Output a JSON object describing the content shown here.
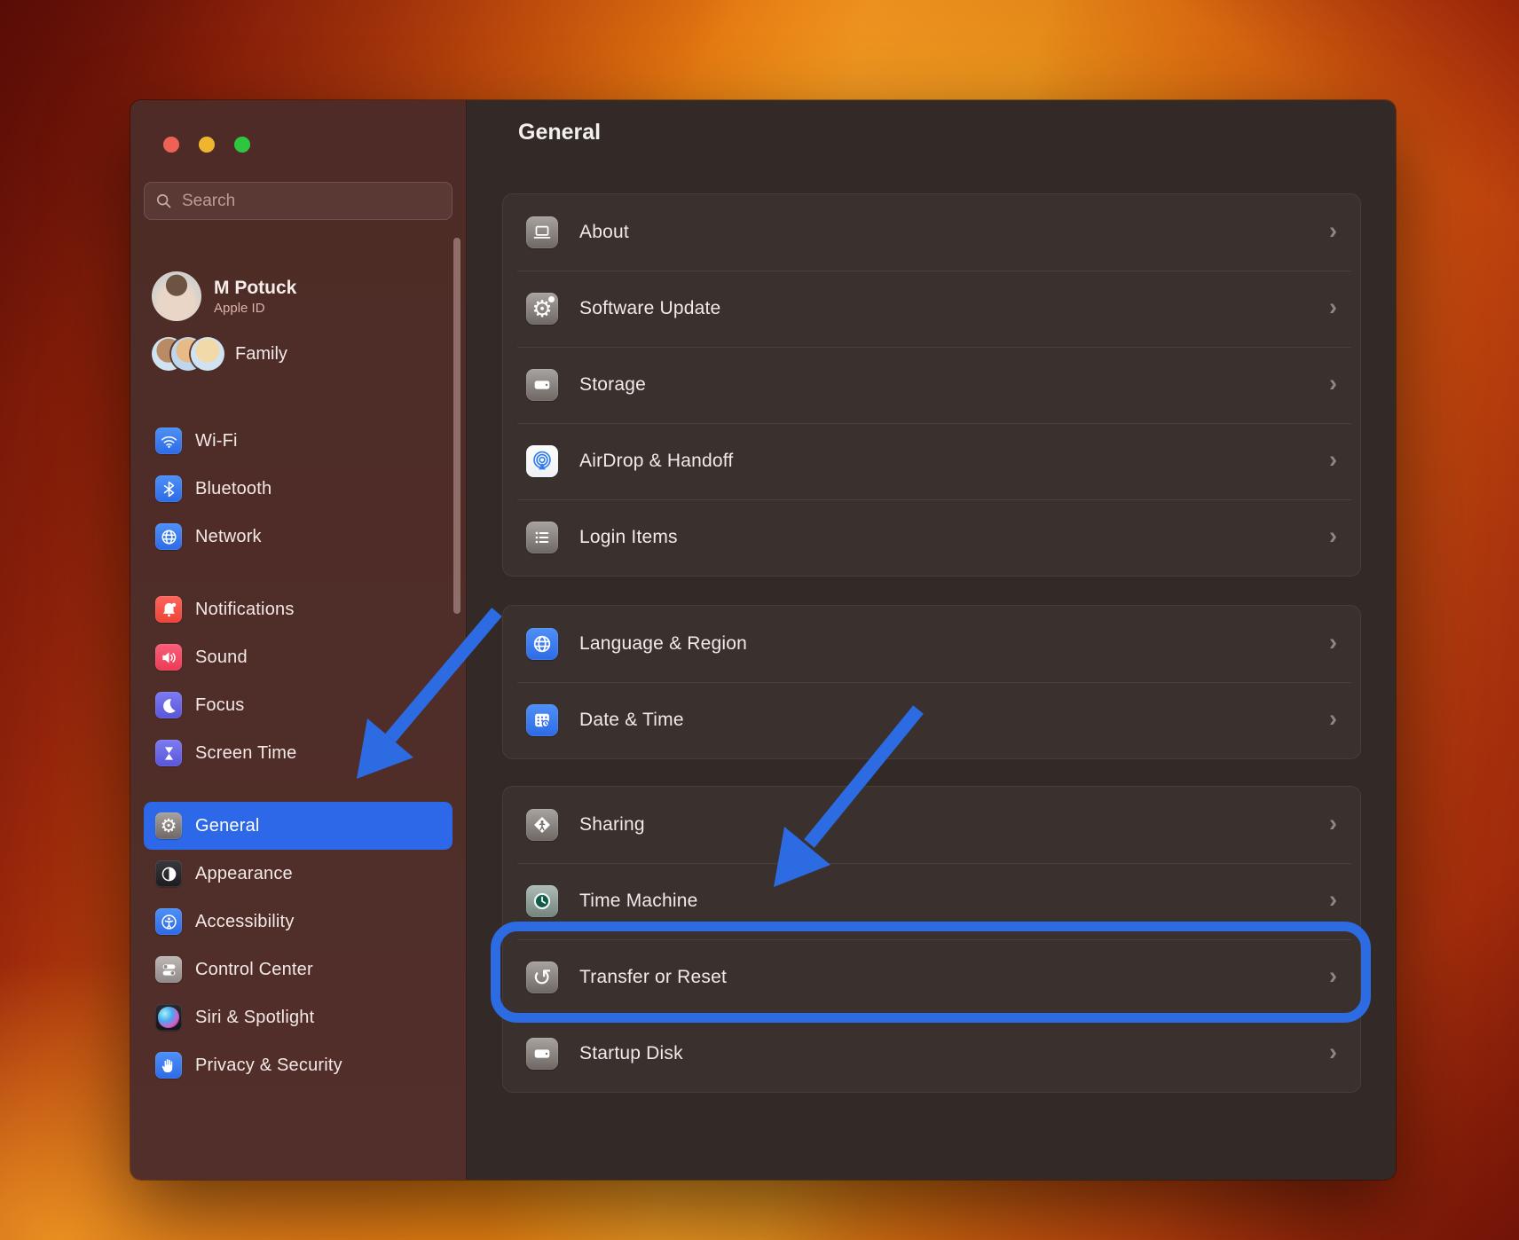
{
  "theme": {
    "accent_blue": "#2c6be2",
    "window_bg": "#332a28",
    "sidebar_bg": "#4e2b26",
    "traffic_red": "#ee6156",
    "traffic_yellow": "#efb52f",
    "traffic_green": "#2fc63f"
  },
  "window": {
    "traffic_lights": [
      "close",
      "minimize",
      "zoom"
    ]
  },
  "sidebar": {
    "search": {
      "placeholder": "Search",
      "icon": "search-icon"
    },
    "profile": {
      "name": "M Potuck",
      "subtitle": "Apple ID"
    },
    "family": {
      "label": "Family"
    },
    "nav_groups": [
      {
        "items": [
          {
            "id": "wifi",
            "label": "Wi-Fi",
            "icon": "wifi-icon",
            "tile": "blue",
            "selected": false
          },
          {
            "id": "bluetooth",
            "label": "Bluetooth",
            "icon": "bluetooth-icon",
            "tile": "blue",
            "selected": false
          },
          {
            "id": "network",
            "label": "Network",
            "icon": "globe-icon",
            "tile": "blue",
            "selected": false
          }
        ]
      },
      {
        "items": [
          {
            "id": "notifications",
            "label": "Notifications",
            "icon": "bell-icon",
            "tile": "red",
            "selected": false
          },
          {
            "id": "sound",
            "label": "Sound",
            "icon": "speaker-icon",
            "tile": "pink",
            "selected": false
          },
          {
            "id": "focus",
            "label": "Focus",
            "icon": "moon-icon",
            "tile": "indigo",
            "selected": false
          },
          {
            "id": "screen-time",
            "label": "Screen Time",
            "icon": "hourglass-icon",
            "tile": "indigo",
            "selected": false
          }
        ]
      },
      {
        "items": [
          {
            "id": "general",
            "label": "General",
            "icon": "gear-icon",
            "tile": "gray",
            "selected": true
          },
          {
            "id": "appearance",
            "label": "Appearance",
            "icon": "appearance-icon",
            "tile": "black",
            "selected": false
          },
          {
            "id": "accessibility",
            "label": "Accessibility",
            "icon": "accessibility-icon",
            "tile": "blue",
            "selected": false
          },
          {
            "id": "control-center",
            "label": "Control Center",
            "icon": "toggles-icon",
            "tile": "lightgray",
            "selected": false
          },
          {
            "id": "siri-spotlight",
            "label": "Siri & Spotlight",
            "icon": "siri-icon",
            "tile": "siri",
            "selected": false
          },
          {
            "id": "privacy-security",
            "label": "Privacy & Security",
            "icon": "hand-icon",
            "tile": "blue",
            "selected": false
          }
        ]
      }
    ]
  },
  "main": {
    "title": "General",
    "chevron": "›",
    "groups": [
      {
        "rows": [
          {
            "id": "about",
            "label": "About",
            "icon": "laptop-icon",
            "tile": "gray"
          },
          {
            "id": "software-update",
            "label": "Software Update",
            "icon": "gear-badge-icon",
            "tile": "gray"
          },
          {
            "id": "storage",
            "label": "Storage",
            "icon": "drive-icon",
            "tile": "gray"
          },
          {
            "id": "airdrop-handoff",
            "label": "AirDrop & Handoff",
            "icon": "airdrop-icon",
            "tile": "white"
          },
          {
            "id": "login-items",
            "label": "Login Items",
            "icon": "list-icon",
            "tile": "gray"
          }
        ]
      },
      {
        "rows": [
          {
            "id": "language-region",
            "label": "Language & Region",
            "icon": "globe-icon",
            "tile": "blue"
          },
          {
            "id": "date-time",
            "label": "Date & Time",
            "icon": "calendar-icon",
            "tile": "blue"
          }
        ]
      },
      {
        "rows": [
          {
            "id": "sharing",
            "label": "Sharing",
            "icon": "sharing-icon",
            "tile": "gray"
          },
          {
            "id": "time-machine",
            "label": "Time Machine",
            "icon": "time-machine-icon",
            "tile": "green"
          },
          {
            "id": "transfer-or-reset",
            "label": "Transfer or Reset",
            "icon": "reset-arrow-icon",
            "tile": "gray",
            "annotated": true
          },
          {
            "id": "startup-disk",
            "label": "Startup Disk",
            "icon": "drive-icon",
            "tile": "gray"
          }
        ]
      }
    ]
  },
  "annotations": {
    "highlight_target": "transfer-or-reset",
    "color": "#2c6be2",
    "arrows": [
      {
        "points_to": "general-sidebar-item"
      },
      {
        "points_to": "transfer-or-reset-row"
      }
    ]
  }
}
